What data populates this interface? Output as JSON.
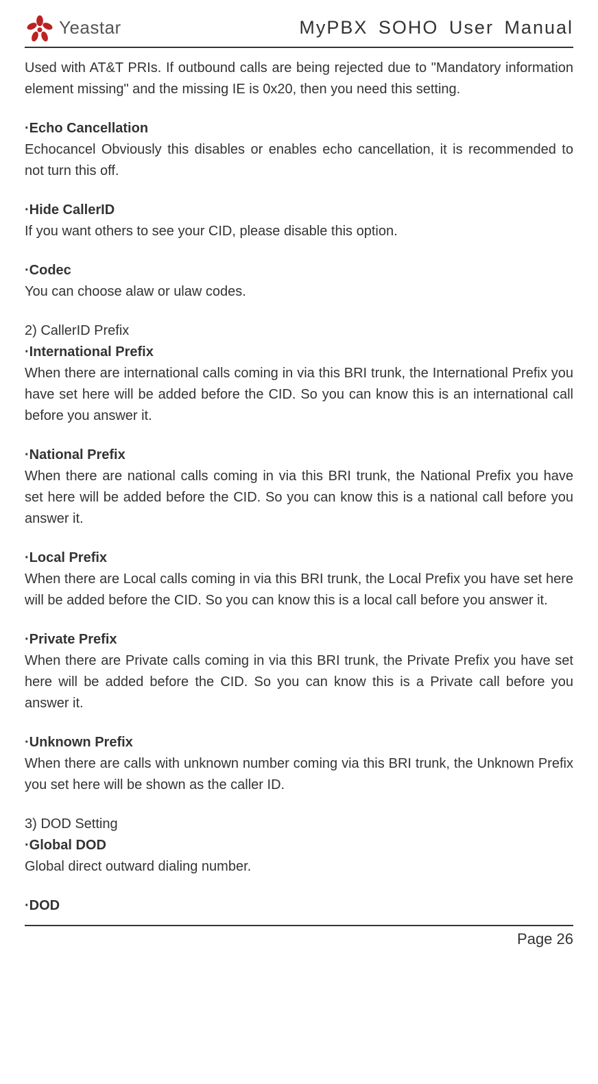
{
  "header": {
    "brand": "Yeastar",
    "title": "MyPBX SOHO User Manual"
  },
  "content": {
    "intro": "Used with AT&T PRIs. If outbound calls are being rejected due to \"Mandatory information element missing\" and the missing IE is 0x20, then you need this setting.",
    "echo_h": "·Echo Cancellation",
    "echo_p": "Echocancel Obviously this disables or enables echo cancellation, it is recommended to not turn this off.",
    "hide_h": "·Hide CallerID",
    "hide_p": "If you want others to see your CID, please disable this option.",
    "codec_h": "·Codec",
    "codec_p": "You can choose alaw or ulaw codes.",
    "sec2": "2)  CallerID Prefix",
    "intl_h": "·International Prefix",
    "intl_p": "When there are international calls coming in via this BRI trunk, the International Prefix you have set here will be added before the CID. So you can know this is an international call before you answer it.",
    "nat_h": "·National Prefix",
    "nat_p": "When there are national calls coming in via this BRI trunk, the National Prefix you have set here will be added before the CID. So you can know this is a national call before you answer it.",
    "loc_h": "·Local Prefix",
    "loc_p": "When there are Local calls coming in via this BRI trunk, the Local Prefix you have set here will be added before the CID. So you can know this is a local call before you answer it.",
    "priv_h": "·Private Prefix",
    "priv_p": "When there are Private calls coming in via this BRI trunk, the Private Prefix you have set here will be added before the CID. So you can know this is a Private call before you answer it.",
    "unk_h": "·Unknown Prefix",
    "unk_p": "When there are calls with unknown number coming via this BRI trunk, the Unknown Prefix you set here will be shown as the caller ID.",
    "sec3": "3)  DOD Setting",
    "gdod_h": "·Global DOD",
    "gdod_p": "Global direct outward dialing number.",
    "dod_h": "·DOD"
  },
  "footer": {
    "page": "Page 26"
  }
}
